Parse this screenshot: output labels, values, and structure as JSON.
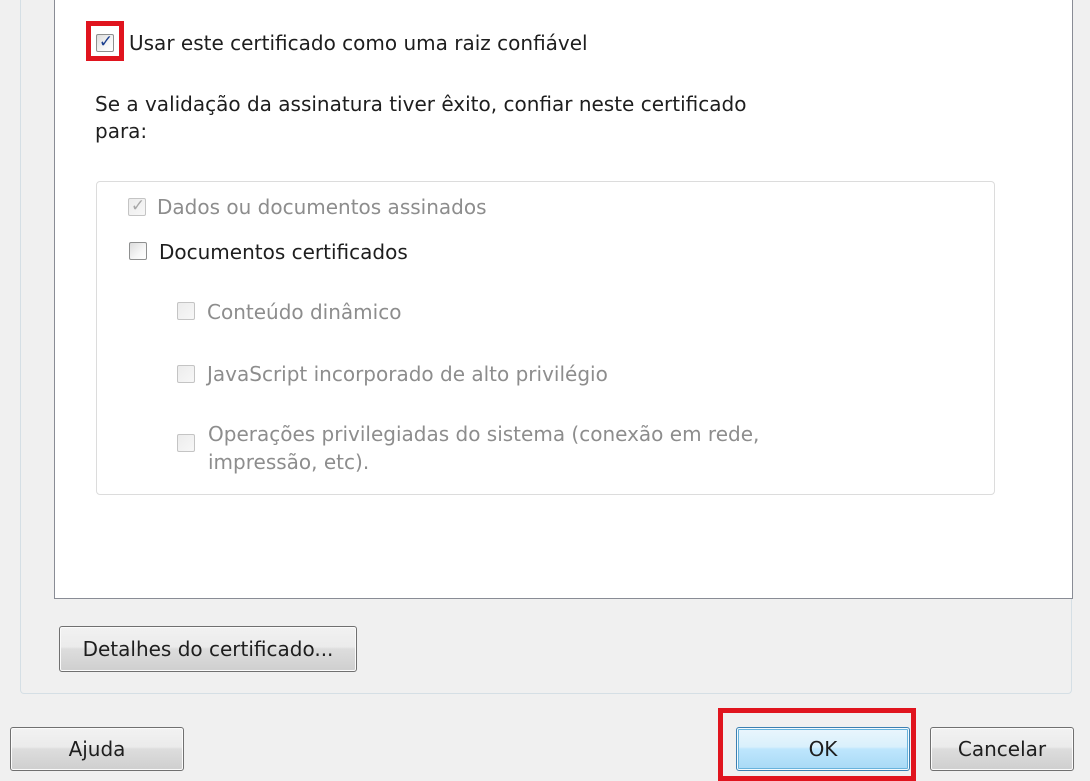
{
  "trust": {
    "root_checkbox": {
      "label": "Usar este certificado como uma raiz confiável",
      "checked": true
    },
    "description_line1": "Se a validação da assinatura tiver êxito, confiar neste certificado",
    "description_line2": "para:",
    "options": {
      "signed_data": {
        "label": "Dados ou documentos assinados",
        "checked": true,
        "enabled": false
      },
      "certified_docs": {
        "label": "Documentos certificados",
        "checked": false,
        "enabled": true
      },
      "dynamic_content": {
        "label": "Conteúdo dinâmico",
        "checked": false,
        "enabled": false
      },
      "javascript": {
        "label": "JavaScript incorporado de alto privilégio",
        "checked": false,
        "enabled": false
      },
      "system_ops": {
        "label_line1": "Operações privilegiadas do sistema (conexão em rede,",
        "label_line2": "impressão, etc).",
        "checked": false,
        "enabled": false
      }
    }
  },
  "details_button": "Detalhes do certificado...",
  "footer": {
    "help_button": "Ajuda",
    "ok_button": "OK",
    "cancel_button": "Cancelar"
  },
  "colors": {
    "highlight": "#e0141e",
    "check_mark": "#1c3f8f",
    "default_button_border": "#3c7fb1"
  },
  "icons": {
    "checked": "check-mark-icon"
  }
}
